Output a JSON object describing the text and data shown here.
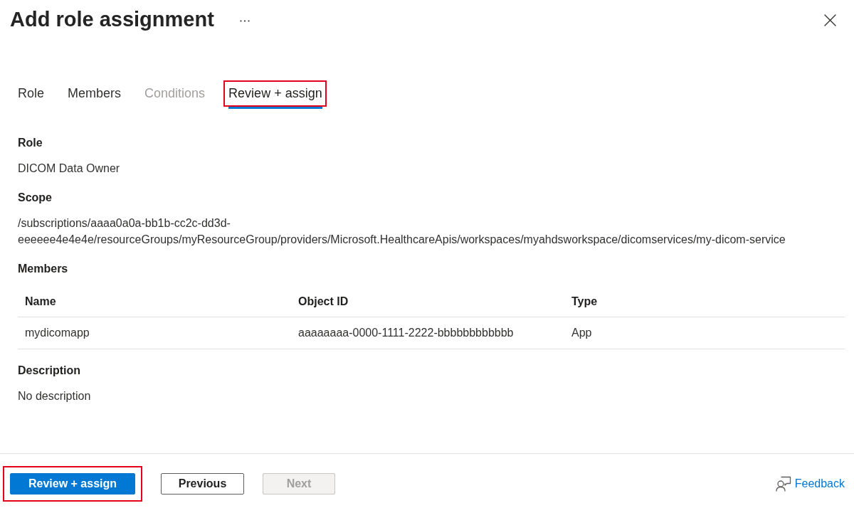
{
  "header": {
    "title": "Add role assignment"
  },
  "tabs": [
    {
      "label": "Role",
      "selected": false,
      "disabled": false,
      "highlighted": false
    },
    {
      "label": "Members",
      "selected": false,
      "disabled": false,
      "highlighted": false
    },
    {
      "label": "Conditions",
      "selected": false,
      "disabled": true,
      "highlighted": false
    },
    {
      "label": "Review + assign",
      "selected": true,
      "disabled": false,
      "highlighted": true
    }
  ],
  "sections": [
    {
      "kind": "text",
      "heading": "Role",
      "value": "DICOM Data Owner"
    },
    {
      "kind": "text",
      "heading": "Scope",
      "value": "/subscriptions/aaaa0a0a-bb1b-cc2c-dd3d-eeeeee4e4e4e/resourceGroups/myResourceGroup/providers/Microsoft.HealthcareApis/workspaces/myahdsworkspace/dicomservices/my-dicom-service"
    },
    {
      "kind": "table",
      "heading": "Members",
      "columns": [
        "Name",
        "Object ID",
        "Type"
      ],
      "rows": [
        [
          "mydicomapp",
          "aaaaaaaa-0000-1111-2222-bbbbbbbbbbbb",
          "App"
        ]
      ]
    },
    {
      "kind": "text",
      "heading": "Description",
      "value": "No description"
    }
  ],
  "footer": {
    "buttons": [
      {
        "label": "Review + assign",
        "kind": "primary",
        "disabled": false,
        "highlighted": true
      },
      {
        "label": "Previous",
        "kind": "secondary",
        "disabled": false,
        "highlighted": false
      },
      {
        "label": "Next",
        "kind": "secondary",
        "disabled": true,
        "highlighted": false
      }
    ],
    "feedback": {
      "label": "Feedback"
    }
  }
}
